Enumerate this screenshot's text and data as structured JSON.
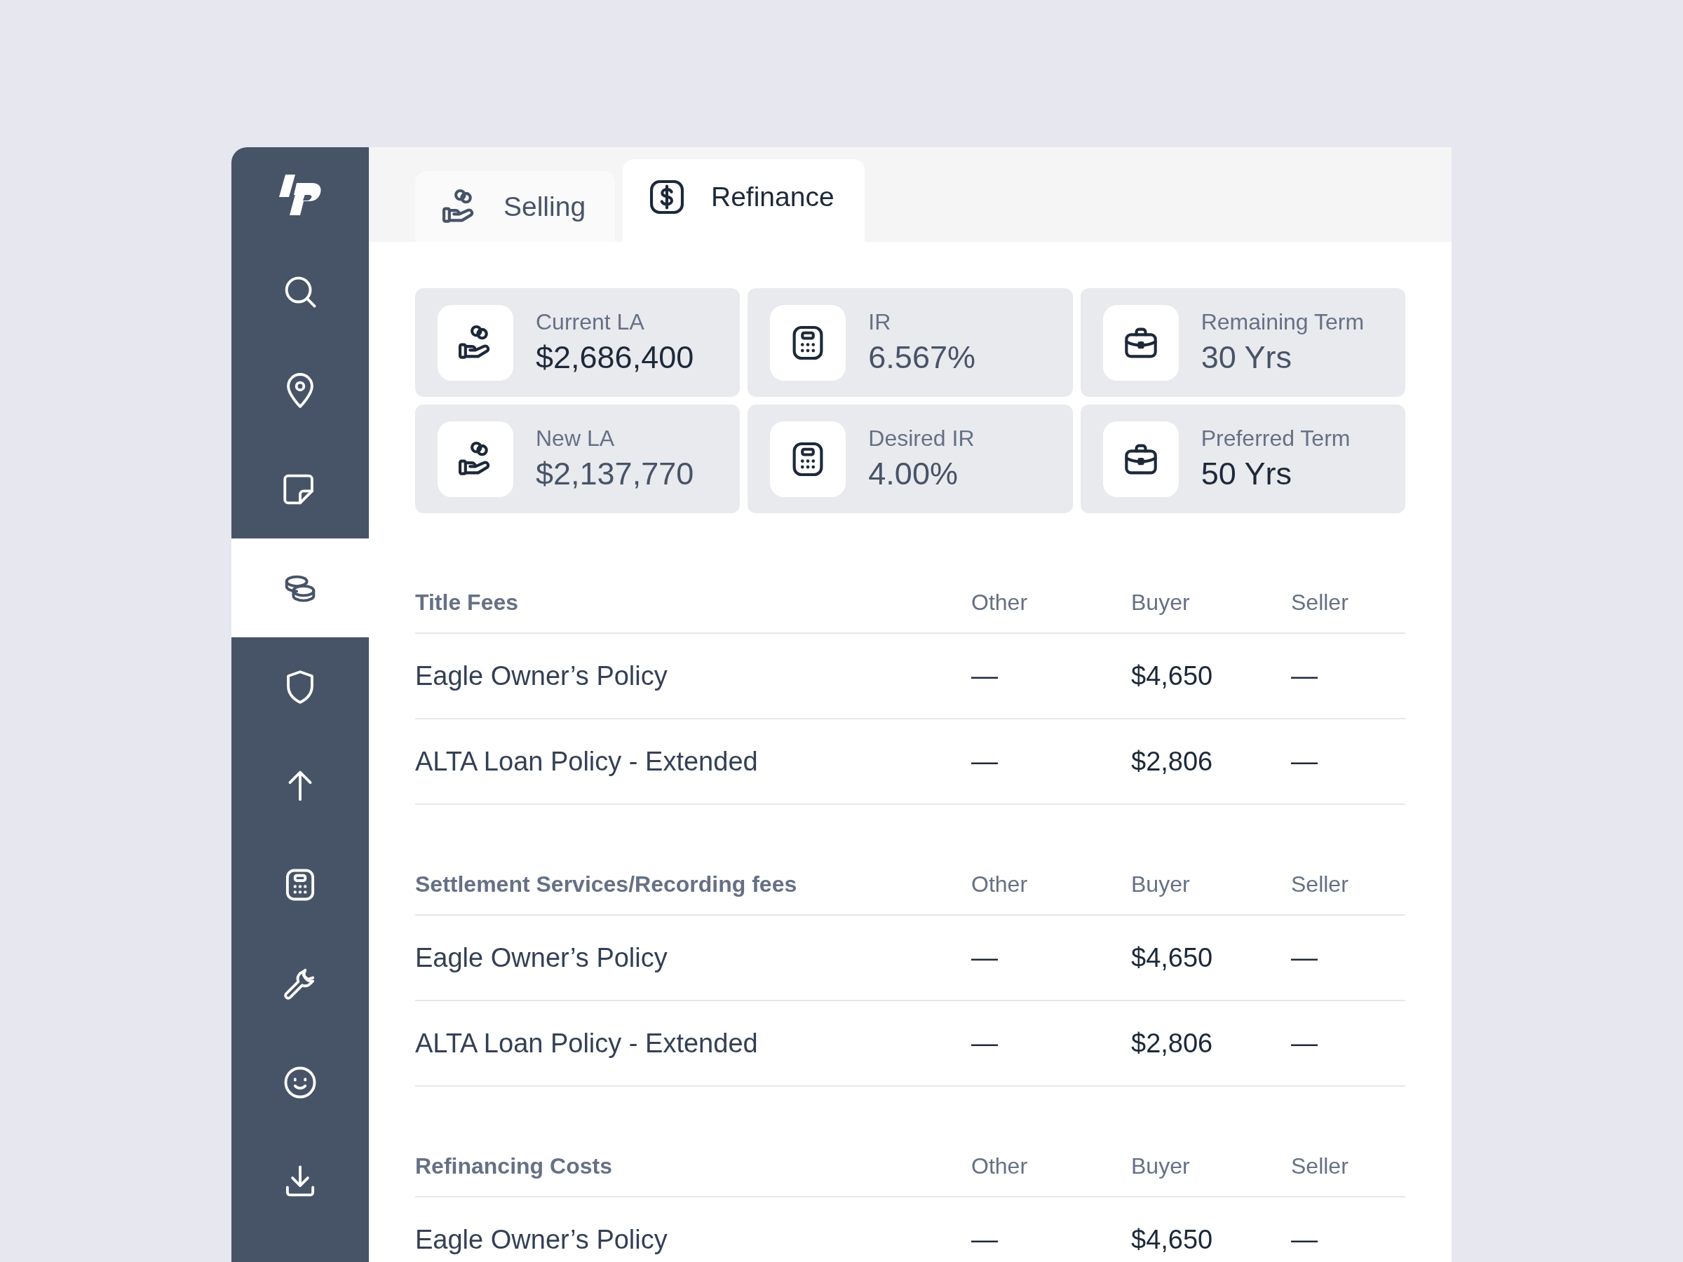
{
  "sidebar": {
    "items": [
      {
        "selected": false
      },
      {
        "selected": false
      },
      {
        "selected": false
      },
      {
        "selected": true
      },
      {
        "selected": false
      },
      {
        "selected": false
      },
      {
        "selected": false
      },
      {
        "selected": false
      },
      {
        "selected": false
      },
      {
        "selected": false
      }
    ]
  },
  "tabs": [
    {
      "label": "Selling",
      "selected": false
    },
    {
      "label": "Refinance",
      "selected": true
    }
  ],
  "stats": [
    {
      "label": "Current LA",
      "value": "$2,686,400",
      "emphasized": true
    },
    {
      "label": "IR",
      "value": "6.567%",
      "emphasized": false
    },
    {
      "label": "Remaining Term",
      "value": "30 Yrs",
      "emphasized": false
    },
    {
      "label": "New LA",
      "value": "$2,137,770",
      "emphasized": false
    },
    {
      "label": "Desired IR",
      "value": "4.00%",
      "emphasized": false
    },
    {
      "label": "Preferred Term",
      "value": "50 Yrs",
      "emphasized": true
    }
  ],
  "sections": [
    {
      "title": "Title Fees",
      "columns": [
        "Other",
        "Buyer",
        "Seller"
      ],
      "rows": [
        {
          "name": "Eagle Owner’s Policy",
          "cells": [
            "—",
            "$4,650",
            "—"
          ]
        },
        {
          "name": "ALTA Loan Policy - Extended",
          "cells": [
            "—",
            "$2,806",
            "—"
          ]
        }
      ]
    },
    {
      "title": "Settlement Services/Recording fees",
      "columns": [
        "Other",
        "Buyer",
        "Seller"
      ],
      "rows": [
        {
          "name": "Eagle Owner’s Policy",
          "cells": [
            "—",
            "$4,650",
            "—"
          ]
        },
        {
          "name": "ALTA Loan Policy - Extended",
          "cells": [
            "—",
            "$2,806",
            "—"
          ]
        }
      ]
    },
    {
      "title": "Refinancing Costs",
      "columns": [
        "Other",
        "Buyer",
        "Seller"
      ],
      "rows": [
        {
          "name": "Eagle Owner’s Policy",
          "cells": [
            "—",
            "$4,650",
            "—"
          ]
        }
      ]
    }
  ]
}
